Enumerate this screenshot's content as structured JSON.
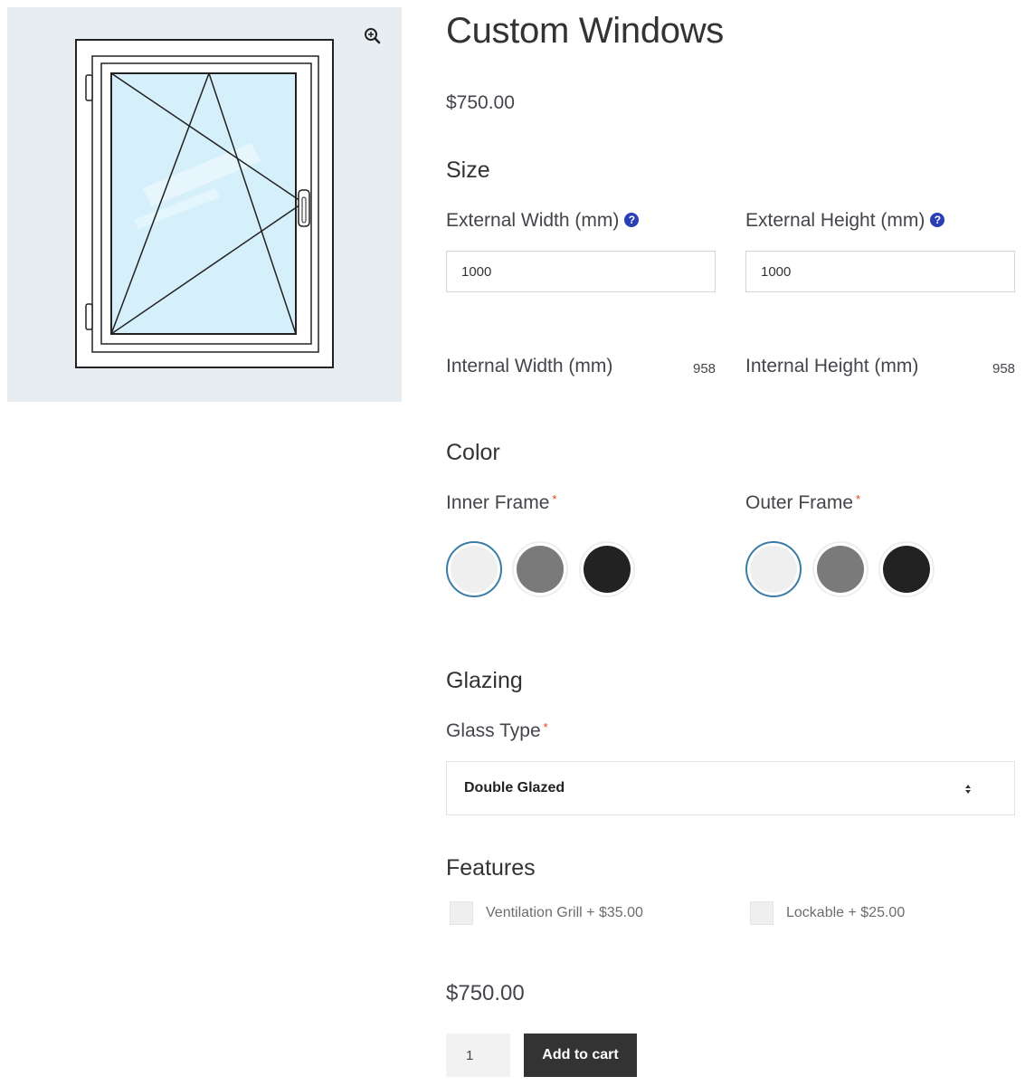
{
  "product": {
    "title": "Custom Windows",
    "price": "$750.00"
  },
  "image": {
    "zoom_icon": "zoom-in-icon",
    "glass_color": "#d6f0fb",
    "background": "#e8edf1"
  },
  "size": {
    "heading": "Size",
    "external_width": {
      "label": "External Width (mm)",
      "value": "1000",
      "help_icon": "question-circle-icon"
    },
    "external_height": {
      "label": "External Height (mm)",
      "value": "1000",
      "help_icon": "question-circle-icon"
    },
    "internal_width": {
      "label": "Internal Width (mm)",
      "value": "958"
    },
    "internal_height": {
      "label": "Internal Height (mm)",
      "value": "958"
    }
  },
  "color": {
    "heading": "Color",
    "inner_frame": {
      "label": "Inner Frame",
      "required_mark": "*",
      "swatches": [
        {
          "color": "#efefef",
          "selected": true
        },
        {
          "color": "#7a7a7a",
          "selected": false
        },
        {
          "color": "#222222",
          "selected": false
        }
      ]
    },
    "outer_frame": {
      "label": "Outer Frame",
      "required_mark": "*",
      "swatches": [
        {
          "color": "#efefef",
          "selected": true
        },
        {
          "color": "#7a7a7a",
          "selected": false
        },
        {
          "color": "#222222",
          "selected": false
        }
      ]
    }
  },
  "glazing": {
    "heading": "Glazing",
    "glass_type": {
      "label": "Glass Type",
      "required_mark": "*",
      "selected": "Double Glazed"
    }
  },
  "features": {
    "heading": "Features",
    "options": [
      {
        "label": "Ventilation Grill + $35.00",
        "checked": false
      },
      {
        "label": "Lockable + $25.00",
        "checked": false
      }
    ]
  },
  "cart": {
    "total": "$750.00",
    "quantity": "1",
    "add_button": "Add to cart"
  },
  "colors": {
    "accent_selected": "#3a7ca5",
    "required": "#e2401c",
    "help": "#2a3fb5",
    "button": "#333333"
  }
}
